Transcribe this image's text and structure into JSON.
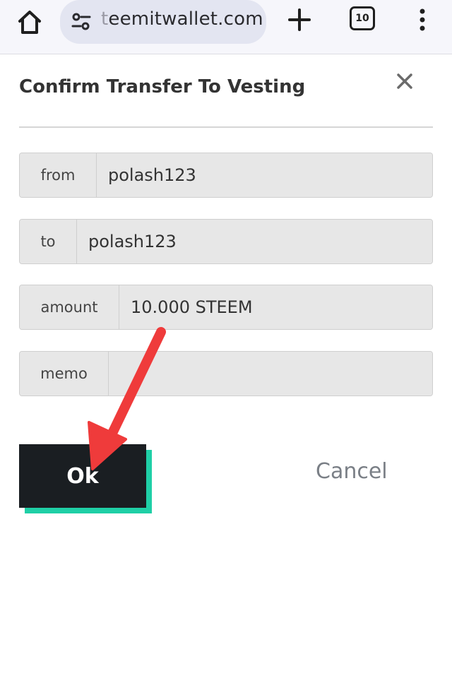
{
  "browser": {
    "url_faded": "t",
    "url_text": "eemitwallet.com",
    "tab_count": "10",
    "icons": {
      "home": "home-icon",
      "site_settings": "tune-icon",
      "new_tab": "plus-icon",
      "tabs": "tab-switcher-icon",
      "menu": "more-vert-icon"
    }
  },
  "dialog": {
    "title": "Confirm Transfer To Vesting",
    "close_icon": "close-icon",
    "fields": [
      {
        "label": "from",
        "value": "polash123"
      },
      {
        "label": "to",
        "value": "polash123"
      },
      {
        "label": "amount",
        "value": "10.000 STEEM"
      },
      {
        "label": "memo",
        "value": ""
      }
    ],
    "ok_label": "Ok",
    "cancel_label": "Cancel"
  },
  "colors": {
    "ok_button": "#1a1e22",
    "ok_accent": "#1fcfa6",
    "annotation_arrow": "#ef3b3b"
  }
}
